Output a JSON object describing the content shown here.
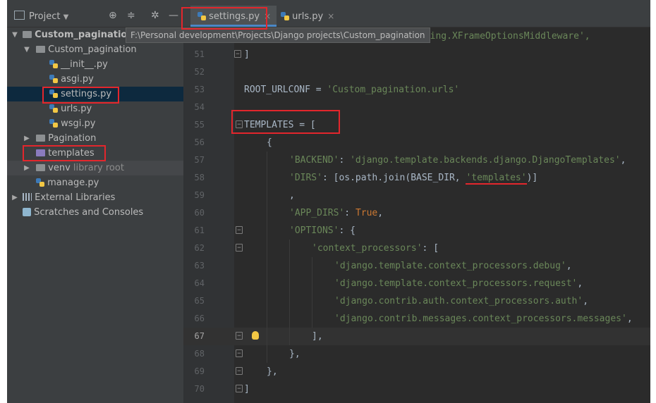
{
  "project_panel": {
    "title": "Project",
    "tree": [
      {
        "label": "Custom_pagination",
        "extra": "F:\\Personal development\\Projects\\Django projects\\Custom_pagination",
        "type": "root"
      },
      {
        "label": "Custom_pagination",
        "type": "folder"
      },
      {
        "label": "__init__.py",
        "type": "py"
      },
      {
        "label": "asgi.py",
        "type": "py"
      },
      {
        "label": "settings.py",
        "type": "py"
      },
      {
        "label": "urls.py",
        "type": "py"
      },
      {
        "label": "wsgi.py",
        "type": "py"
      },
      {
        "label": "Pagination",
        "type": "folder"
      },
      {
        "label": "templates",
        "type": "folder-purple"
      },
      {
        "label": "venv",
        "extra": "library root",
        "type": "folder"
      },
      {
        "label": "manage.py",
        "type": "py"
      },
      {
        "label": "External Libraries",
        "type": "lib"
      },
      {
        "label": "Scratches and Consoles",
        "type": "scratch"
      }
    ]
  },
  "tabs": [
    {
      "label": "settings.py"
    },
    {
      "label": "urls.py"
    }
  ],
  "editor": {
    "top_partial": "cking.XFrameOptionsMiddleware',",
    "lines": [
      {
        "n": "51",
        "t1": "]"
      },
      {
        "n": "52"
      },
      {
        "n": "53",
        "t1": "ROOT_URLCONF = ",
        "s1": "'Custom_pagination.urls'"
      },
      {
        "n": "54"
      },
      {
        "n": "55",
        "t1": "TEMPLATES = ["
      },
      {
        "n": "56",
        "t1": "{"
      },
      {
        "n": "57",
        "s1": "'BACKEND'",
        "t1": ": ",
        "s2": "'django.template.backends.django.DjangoTemplates'",
        "t2": ","
      },
      {
        "n": "58",
        "s1": "'DIRS'",
        "t1": ": [os.path.join(BASE_DIR, ",
        "s2": "'templates'",
        "t2": ")]"
      },
      {
        "n": "59",
        "t1": ","
      },
      {
        "n": "60",
        "s1": "'APP_DIRS'",
        "t1": ": ",
        "k1": "True",
        "t2": ","
      },
      {
        "n": "61",
        "s1": "'OPTIONS'",
        "t1": ": {"
      },
      {
        "n": "62",
        "s1": "'context_processors'",
        "t1": ": ["
      },
      {
        "n": "63",
        "s1": "'django.template.context_processors.debug'",
        "t1": ","
      },
      {
        "n": "64",
        "s1": "'django.template.context_processors.request'",
        "t1": ","
      },
      {
        "n": "65",
        "s1": "'django.contrib.auth.context_processors.auth'",
        "t1": ","
      },
      {
        "n": "66",
        "s1": "'django.contrib.messages.context_processors.messages'",
        "t1": ","
      },
      {
        "n": "67",
        "t1": "],"
      },
      {
        "n": "68",
        "t1": "},"
      },
      {
        "n": "69",
        "t1": "},"
      },
      {
        "n": "70",
        "t1": "]"
      }
    ]
  }
}
